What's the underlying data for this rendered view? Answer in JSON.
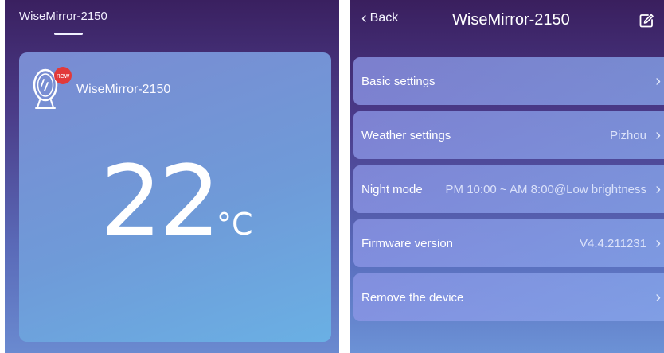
{
  "left_screen": {
    "title": "WiseMirror-2150",
    "card": {
      "badge": "new",
      "device_name": "WiseMirror-2150",
      "temperature": "22",
      "unit": "°C"
    }
  },
  "right_screen": {
    "back_label": "Back",
    "title": "WiseMirror-2150",
    "rows": [
      {
        "label": "Basic settings",
        "value": ""
      },
      {
        "label": "Weather settings",
        "value": "Pizhou"
      },
      {
        "label": "Night mode",
        "value": "PM 10:00 ~ AM 8:00@Low brightness"
      },
      {
        "label": "Firmware version",
        "value": "V4.4.211231"
      },
      {
        "label": "Remove the device",
        "value": ""
      }
    ]
  },
  "icons": {
    "mirror": "mirror-icon",
    "back": "chevron-left-icon",
    "edit": "edit-icon",
    "row": "chevron-right-icon"
  },
  "colors": {
    "badge": "#e23a3a",
    "card": "#6f9ad8"
  }
}
